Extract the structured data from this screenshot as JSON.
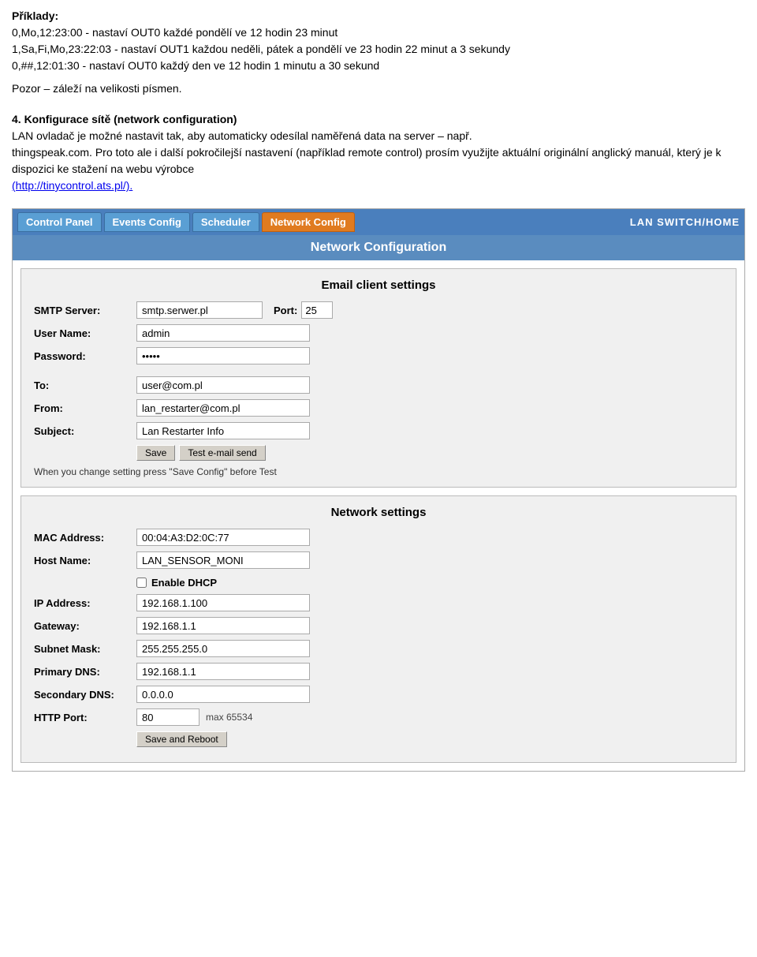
{
  "examples": {
    "heading": "Příklady:",
    "line1": "0,Mo,12:23:00 - nastaví OUT0 každé pondělí ve 12 hodin 23 minut",
    "line2": "1,Sa,Fi,Mo,23:22:03 - nastaví OUT1 každou neděli, pátek a pondělí ve 23 hodin 22 minut a 3 sekundy",
    "line3": "0,##,12:01:30 - nastaví OUT0 každý den ve 12 hodin 1 minutu a 30 sekund",
    "note": "Pozor – záleží na velikosti písmen."
  },
  "section4": {
    "heading": "4. Konfigurace sítě (network configuration)",
    "text1": "LAN ovladač je možné nastavit tak, aby automaticky odesílal naměřená data na server – např.",
    "text2": "thingspeak.com. Pro toto ale i další pokročilejší nastavení (například remote control) prosím využijte aktuální originální anglický manuál, který je k dispozici ke stažení na webu výrobce",
    "link": "(http://tinycontrol.ats.pl/)."
  },
  "nav": {
    "brand": "LAN SWITCH/HOME",
    "tabs": [
      {
        "label": "Control Panel",
        "active": false
      },
      {
        "label": "Events Config",
        "active": false
      },
      {
        "label": "Scheduler",
        "active": false
      },
      {
        "label": "Network Config",
        "active": true
      }
    ],
    "section_title": "Network Configuration"
  },
  "email_panel": {
    "title": "Email client settings",
    "smtp_label": "SMTP Server:",
    "smtp_value": "smtp.serwer.pl",
    "port_label": "Port:",
    "port_value": "25",
    "username_label": "User Name:",
    "username_value": "admin",
    "password_label": "Password:",
    "password_dots": "•••••",
    "to_label": "To:",
    "to_value": "user@com.pl",
    "from_label": "From:",
    "from_value": "lan_restarter@com.pl",
    "subject_label": "Subject:",
    "subject_value": "Lan Restarter Info",
    "save_button": "Save",
    "test_button": "Test e-mail send",
    "note": "When you change setting press \"Save Config\" before Test"
  },
  "network_panel": {
    "title": "Network settings",
    "mac_label": "MAC Address:",
    "mac_value": "00:04:A3:D2:0C:77",
    "hostname_label": "Host Name:",
    "hostname_value": "LAN_SENSOR_MONI",
    "dhcp_label": "Enable DHCP",
    "dhcp_checked": false,
    "ip_label": "IP Address:",
    "ip_value": "192.168.1.100",
    "gateway_label": "Gateway:",
    "gateway_value": "192.168.1.1",
    "subnet_label": "Subnet Mask:",
    "subnet_value": "255.255.255.0",
    "primary_dns_label": "Primary DNS:",
    "primary_dns_value": "192.168.1.1",
    "secondary_dns_label": "Secondary DNS:",
    "secondary_dns_value": "0.0.0.0",
    "http_port_label": "HTTP Port:",
    "http_port_value": "80",
    "http_port_max": "max 65534",
    "save_reboot_button": "Save and Reboot"
  }
}
